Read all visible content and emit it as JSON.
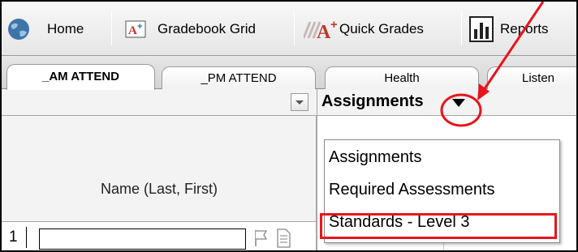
{
  "toolbar": {
    "items": [
      {
        "label": "Home",
        "icon": "home-globe-icon"
      },
      {
        "label": "Gradebook Grid",
        "icon": "gradebook-grid-icon"
      },
      {
        "label": "Quick Grades",
        "icon": "quick-grades-icon"
      },
      {
        "label": "Reports",
        "icon": "reports-chart-icon"
      }
    ]
  },
  "tabs": [
    {
      "label": "_AM ATTEND",
      "active": true
    },
    {
      "label": "_PM ATTEND",
      "active": false
    },
    {
      "label": "Health",
      "active": false
    },
    {
      "label": "Listen",
      "active": false
    }
  ],
  "grid": {
    "name_header": "Name (Last, First)",
    "assignments_header": "Assignments",
    "row1_number": "1",
    "row1_name_value": ""
  },
  "dropdown": {
    "options": [
      {
        "label": "Assignments"
      },
      {
        "label": "Required Assessments"
      },
      {
        "label": "Standards - Level 3",
        "highlighted": true
      }
    ]
  },
  "annotation": {
    "color": "#e8141c"
  }
}
